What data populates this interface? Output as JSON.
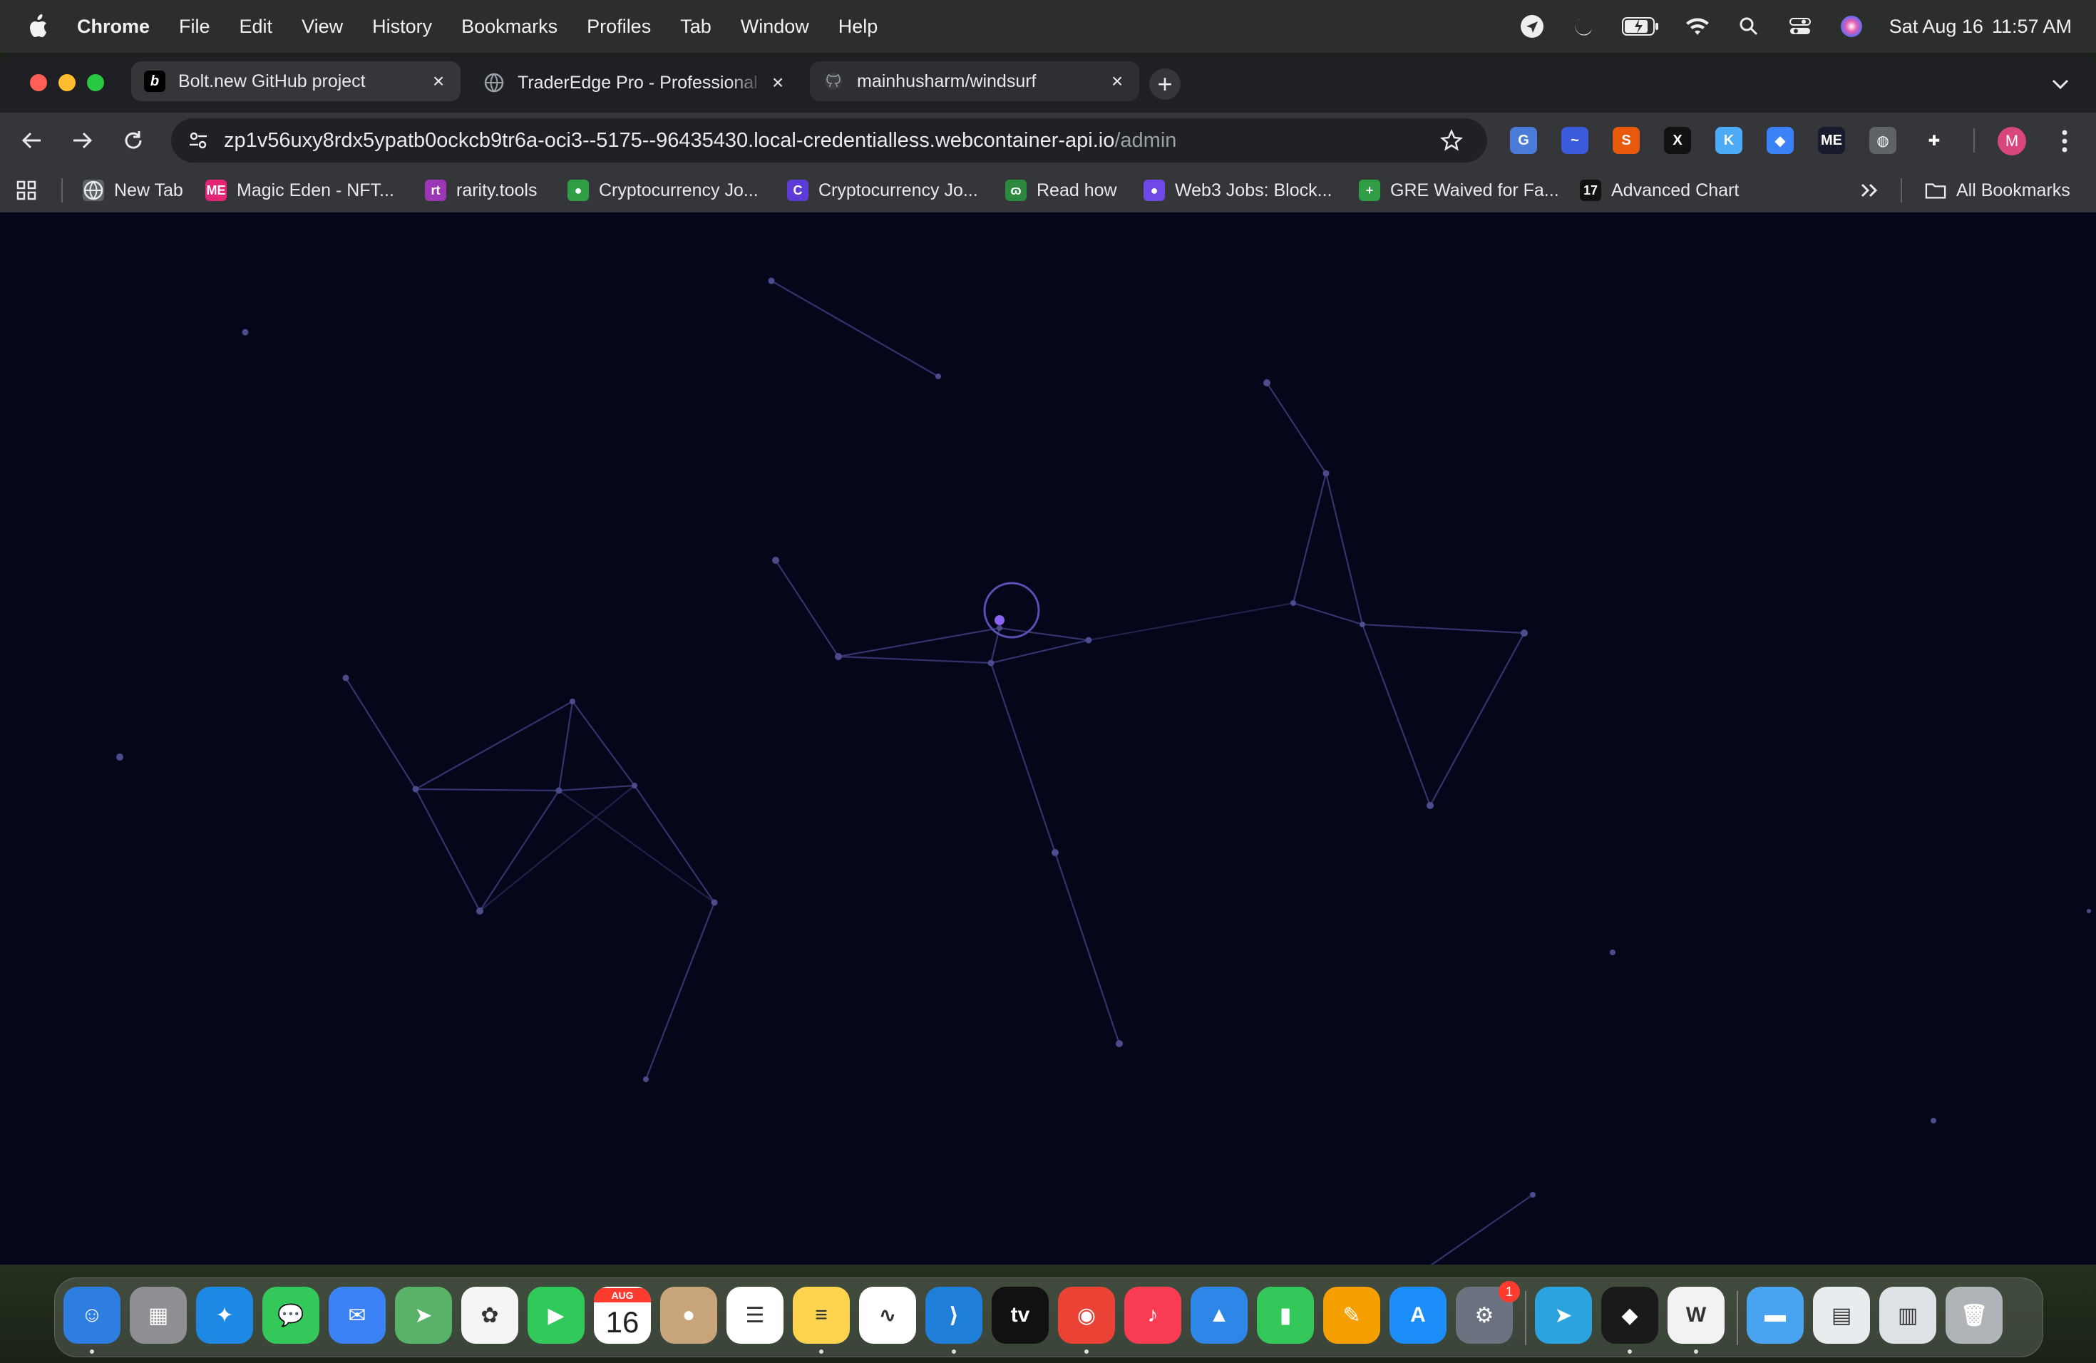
{
  "menubar": {
    "app": "Chrome",
    "items": [
      "File",
      "Edit",
      "View",
      "History",
      "Bookmarks",
      "Profiles",
      "Tab",
      "Window",
      "Help"
    ],
    "status_icons": [
      "location-arrow-icon",
      "moon-icon",
      "battery-icon",
      "wifi-icon",
      "search-icon",
      "control-center-icon",
      "siri-icon"
    ],
    "date": "Sat Aug 16",
    "time": "11:57 AM"
  },
  "tabs": [
    {
      "title": "Bolt.new GitHub project",
      "favicon": "b",
      "active": true
    },
    {
      "title": "TraderEdge Pro - Professional",
      "favicon": "globe",
      "active": false
    },
    {
      "title": "mainhusharm/windsurf",
      "favicon": "github",
      "active": false
    }
  ],
  "toolbar": {
    "url_host": "zp1v56uxy8rdx5ypatb0ockcb9tr6a-oci3--5175--96435430.local-credentialless.webcontainer-api.io",
    "url_path": "/admin",
    "avatar_letter": "M"
  },
  "extensions": [
    {
      "name": "google-translate-icon",
      "label": "G",
      "color": "#4a7bd8"
    },
    {
      "name": "ext-wave-icon",
      "label": "~",
      "color": "#3b5bdb"
    },
    {
      "name": "ext-s-icon",
      "label": "S",
      "color": "#e8590c"
    },
    {
      "name": "x-icon",
      "label": "X",
      "color": "#111111"
    },
    {
      "name": "ext-k-icon",
      "label": "K",
      "color": "#4dabf7"
    },
    {
      "name": "ext-diamond-icon",
      "label": "◆",
      "color": "#3b82f6"
    },
    {
      "name": "magic-eden-icon",
      "label": "ME",
      "color": "#1a1a2e"
    },
    {
      "name": "globe-icon",
      "label": "◍",
      "color": "#5f6368"
    },
    {
      "name": "puzzle-icon",
      "label": "✚",
      "color": "#35363a"
    }
  ],
  "bookmarks": {
    "items": [
      {
        "label": "New Tab",
        "icon": "globe",
        "color": "#5f6368"
      },
      {
        "label": "Magic Eden - NFT...",
        "icon": "ME",
        "color": "#e42575"
      },
      {
        "label": "rarity.tools",
        "icon": "rt",
        "color": "#9c36b5"
      },
      {
        "label": "Cryptocurrency Jo...",
        "icon": "●",
        "color": "#2f9e44"
      },
      {
        "label": "Cryptocurrency Jo...",
        "icon": "C",
        "color": "#5c3bd9"
      },
      {
        "label": "Read how",
        "icon": "ɷ",
        "color": "#2b8a3e"
      },
      {
        "label": "Web3 Jobs: Block...",
        "icon": "●",
        "color": "#7048e8"
      },
      {
        "label": "GRE Waived for Fa...",
        "icon": "+",
        "color": "#2f9e44"
      },
      {
        "label": "Advanced Chart",
        "icon": "17",
        "color": "#111111"
      }
    ],
    "all_bookmarks": "All Bookmarks"
  },
  "dock": {
    "apps": [
      {
        "name": "finder",
        "label": "☺",
        "color": "#2e7de1"
      },
      {
        "name": "launchpad",
        "label": "▦",
        "color": "#8e8e93"
      },
      {
        "name": "safari",
        "label": "✦",
        "color": "#1e88e5"
      },
      {
        "name": "messages",
        "label": "💬",
        "color": "#34c759"
      },
      {
        "name": "mail",
        "label": "✉",
        "color": "#3b82f6"
      },
      {
        "name": "maps",
        "label": "➤",
        "color": "#58b368"
      },
      {
        "name": "photos",
        "label": "✿",
        "color": "#f5f5f5"
      },
      {
        "name": "facetime",
        "label": "▶",
        "color": "#30c95a"
      },
      {
        "name": "calendar",
        "label": "16",
        "color": "#ffffff"
      },
      {
        "name": "contacts",
        "label": "●",
        "color": "#c8a47a"
      },
      {
        "name": "reminders",
        "label": "☰",
        "color": "#ffffff"
      },
      {
        "name": "notes",
        "label": "≡",
        "color": "#fbd34d"
      },
      {
        "name": "freeform",
        "label": "∿",
        "color": "#ffffff"
      },
      {
        "name": "vscode",
        "label": "⟩",
        "color": "#1f7ed8"
      },
      {
        "name": "apple-tv",
        "label": "tv",
        "color": "#111111"
      },
      {
        "name": "chrome",
        "label": "◉",
        "color": "#ea4335"
      },
      {
        "name": "music",
        "label": "♪",
        "color": "#fa3c53"
      },
      {
        "name": "keynote",
        "label": "▲",
        "color": "#2e87e8"
      },
      {
        "name": "numbers",
        "label": "▮",
        "color": "#34c759"
      },
      {
        "name": "pages",
        "label": "✎",
        "color": "#f59f00"
      },
      {
        "name": "app-store",
        "label": "A",
        "color": "#1c8ef9"
      },
      {
        "name": "system-settings",
        "label": "⚙",
        "color": "#6b7280"
      },
      {
        "name": "telegram",
        "label": "➤",
        "color": "#2aa3df"
      },
      {
        "name": "cursor",
        "label": "◆",
        "color": "#1a1a1a"
      },
      {
        "name": "windsurf",
        "label": "W",
        "color": "#f2f2f2"
      },
      {
        "name": "folder",
        "label": "▬",
        "color": "#4aa3f0"
      },
      {
        "name": "preview-doc",
        "label": "▤",
        "color": "#e9ecef"
      },
      {
        "name": "screenshot-doc",
        "label": "▥",
        "color": "#dee2e6"
      },
      {
        "name": "trash",
        "label": "🗑",
        "color": "#b0b4b8"
      }
    ],
    "calendar_month": "AUG",
    "settings_badge": "1"
  },
  "colors": {
    "canvas_bg": "#05061a",
    "node": "#4f4f92",
    "edge": "#3a3a72",
    "cursor_dot": "#8a63f0"
  }
}
